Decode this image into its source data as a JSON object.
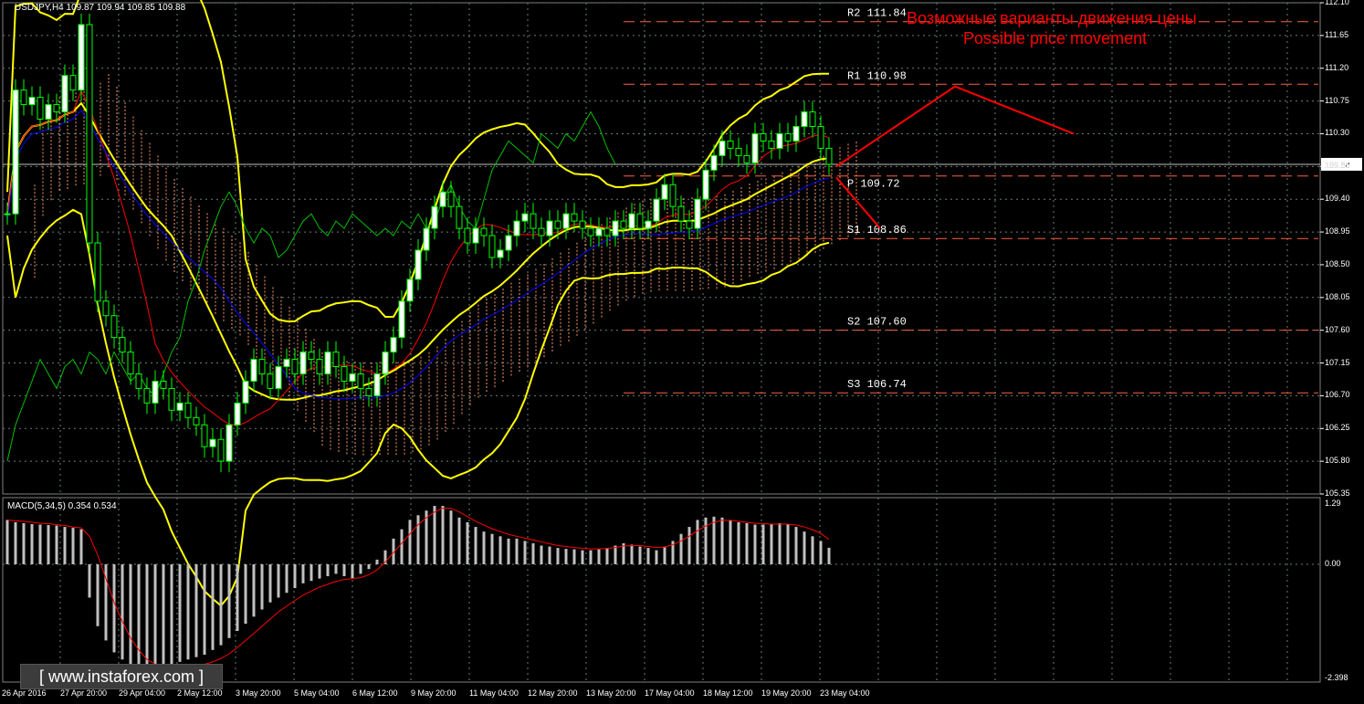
{
  "header": {
    "symbol_info": "USDJPY,H4  109.87 109.94 109.85 109.88",
    "macd_info": "MACD(5,34,5) 0.354 0.534"
  },
  "annotation": {
    "title_ru": "Возможные варианты движения цены",
    "title_en": "Possible price movement"
  },
  "watermark": {
    "text": "www.instaforex.com"
  },
  "current_price_label": "109.88",
  "price_axis": [
    "112.10",
    "111.65",
    "111.20",
    "110.75",
    "110.30",
    "109.85",
    "109.40",
    "108.95",
    "108.50",
    "108.05",
    "107.60",
    "107.15",
    "106.70",
    "106.25",
    "105.80",
    "105.35"
  ],
  "macd_axis": [
    "1.29",
    "0.00",
    "-2.398"
  ],
  "time_axis": [
    "26 Apr 2016",
    "27 Apr 20:00",
    "29 Apr 04:00",
    "2 May 12:00",
    "3 May 20:00",
    "5 May 04:00",
    "6 May 12:00",
    "9 May 20:00",
    "11 May 04:00",
    "12 May 20:00",
    "13 May 20:00",
    "17 May 04:00",
    "18 May 12:00",
    "19 May 20:00",
    "23 May 04:00"
  ],
  "colors": {
    "bollinger": "#ffff00",
    "tenkan": "#ff0000",
    "kijun": "#0000ff",
    "chikou": "#00c000",
    "cloud": "#ff9966",
    "pivot_lines": "#ff6040",
    "forecast": "#ff0000",
    "candle_up": "#ffffff",
    "candle_down": "#00ff00",
    "macd_hist": "#c0c0c0",
    "macd_signal": "#ff0000",
    "grid": "#6b7b7b"
  },
  "chart_data": {
    "type": "candlestick",
    "symbol": "USDJPY",
    "timeframe": "H4",
    "ylim": [
      105.35,
      112.1
    ],
    "pivot_levels": [
      {
        "name": "R2",
        "label": "R2 111.84",
        "value": 111.84
      },
      {
        "name": "R1",
        "label": "R1 110.98",
        "value": 110.98
      },
      {
        "name": "P",
        "label": "P  109.72",
        "value": 109.72
      },
      {
        "name": "S1",
        "label": "S1 108.86",
        "value": 108.86
      },
      {
        "name": "S2",
        "label": "S2 107.60",
        "value": 107.6
      },
      {
        "name": "S3",
        "label": "S3 106.74",
        "value": 106.74
      }
    ],
    "current_price": 109.88,
    "closes": [
      109.2,
      110.9,
      110.7,
      110.8,
      110.5,
      110.7,
      110.6,
      111.1,
      110.9,
      111.8,
      108.8,
      108.0,
      107.8,
      107.5,
      107.3,
      107.0,
      106.8,
      106.6,
      106.9,
      106.8,
      106.5,
      106.6,
      106.4,
      106.3,
      106.0,
      106.1,
      105.8,
      106.3,
      106.6,
      106.9,
      107.2,
      107.0,
      106.8,
      107.1,
      107.2,
      107.0,
      107.3,
      107.2,
      107.0,
      107.3,
      107.1,
      106.9,
      107.0,
      106.8,
      106.7,
      107.0,
      107.3,
      107.5,
      108.0,
      108.3,
      108.7,
      109.0,
      109.3,
      109.5,
      109.3,
      109.0,
      108.8,
      109.0,
      108.9,
      108.6,
      108.7,
      108.9,
      109.1,
      109.2,
      109.0,
      108.9,
      109.1,
      109.0,
      109.2,
      109.1,
      109.0,
      108.9,
      109.0,
      108.9,
      109.1,
      109.0,
      109.2,
      109.0,
      109.1,
      109.4,
      109.6,
      109.3,
      109.1,
      109.0,
      109.4,
      109.8,
      110.0,
      110.2,
      110.1,
      110.0,
      109.9,
      110.3,
      110.2,
      110.1,
      110.3,
      110.2,
      110.4,
      110.6,
      110.4,
      110.1,
      109.88
    ],
    "macd_histogram": [
      0.95,
      0.9,
      0.88,
      0.86,
      0.85,
      0.84,
      0.83,
      0.8,
      0.78,
      0.75,
      -0.7,
      -1.3,
      -1.6,
      -1.85,
      -2.0,
      -2.1,
      -2.15,
      -2.2,
      -2.2,
      -2.15,
      -2.1,
      -2.05,
      -2.0,
      -1.95,
      -1.9,
      -1.8,
      -1.7,
      -1.55,
      -1.4,
      -1.25,
      -1.1,
      -0.95,
      -0.8,
      -0.7,
      -0.6,
      -0.5,
      -0.4,
      -0.35,
      -0.3,
      -0.25,
      -0.2,
      -0.25,
      -0.3,
      -0.2,
      -0.1,
      0.1,
      0.3,
      0.55,
      0.75,
      0.95,
      1.05,
      1.15,
      1.25,
      1.25,
      1.15,
      1.0,
      0.9,
      0.8,
      0.7,
      0.65,
      0.6,
      0.55,
      0.55,
      0.5,
      0.45,
      0.4,
      0.38,
      0.35,
      0.33,
      0.32,
      0.3,
      0.3,
      0.32,
      0.35,
      0.4,
      0.45,
      0.42,
      0.38,
      0.35,
      0.3,
      0.38,
      0.5,
      0.65,
      0.8,
      0.95,
      1.0,
      1.02,
      1.0,
      0.95,
      0.9,
      0.88,
      0.85,
      0.85,
      0.86,
      0.88,
      0.86,
      0.8,
      0.7,
      0.6,
      0.5,
      0.354
    ],
    "macd_signal": [
      0.95,
      0.93,
      0.92,
      0.9,
      0.88,
      0.87,
      0.85,
      0.83,
      0.8,
      0.78,
      0.6,
      0.2,
      -0.3,
      -0.8,
      -1.2,
      -1.55,
      -1.8,
      -2.0,
      -2.1,
      -2.15,
      -2.2,
      -2.2,
      -2.18,
      -2.15,
      -2.1,
      -2.05,
      -1.98,
      -1.88,
      -1.75,
      -1.6,
      -1.45,
      -1.3,
      -1.15,
      -1.0,
      -0.88,
      -0.76,
      -0.65,
      -0.56,
      -0.48,
      -0.42,
      -0.36,
      -0.32,
      -0.3,
      -0.28,
      -0.22,
      -0.12,
      0.05,
      0.25,
      0.45,
      0.65,
      0.85,
      1.0,
      1.12,
      1.2,
      1.2,
      1.12,
      1.02,
      0.92,
      0.84,
      0.76,
      0.7,
      0.64,
      0.6,
      0.56,
      0.52,
      0.48,
      0.44,
      0.4,
      0.38,
      0.36,
      0.34,
      0.33,
      0.33,
      0.34,
      0.36,
      0.39,
      0.4,
      0.4,
      0.38,
      0.36,
      0.37,
      0.42,
      0.5,
      0.6,
      0.72,
      0.82,
      0.9,
      0.94,
      0.94,
      0.92,
      0.9,
      0.88,
      0.87,
      0.86,
      0.86,
      0.86,
      0.84,
      0.8,
      0.74,
      0.66,
      0.534
    ],
    "forecast_up": [
      [
        109.85,
        0
      ],
      [
        110.95,
        1
      ],
      [
        110.3,
        2
      ]
    ],
    "forecast_down": [
      [
        109.7,
        0
      ],
      [
        109.0,
        1
      ]
    ],
    "xlabel": "",
    "ylabel": ""
  }
}
